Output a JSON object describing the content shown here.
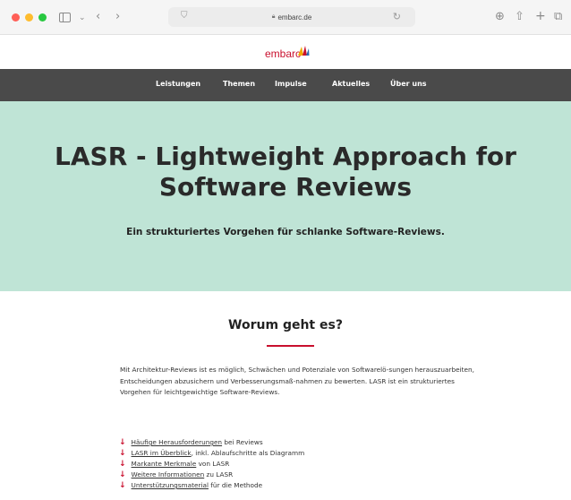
{
  "browser": {
    "url": "embarc.de",
    "icons": [
      "sidebar-icon",
      "chevron-down-icon",
      "back-icon",
      "forward-icon",
      "shield-icon",
      "reload-icon",
      "download-icon",
      "share-icon",
      "new-tab-icon",
      "tabs-icon"
    ]
  },
  "site": {
    "logo_text": "embarc",
    "brand_color": "#c9102e",
    "nav": [
      "Leistungen",
      "Themen",
      "Impulse",
      "Aktuelles",
      "Über uns"
    ]
  },
  "hero": {
    "title": "LASR - Lightweight Approach for Software Reviews",
    "subtitle": "Ein strukturiertes Vorgehen für schlanke Software-Reviews.",
    "background": "#bfe4d6"
  },
  "section": {
    "title": "Worum geht es?",
    "intro": "Mit Architektur-Reviews ist es möglich, Schwächen und Potenziale von Softwarelö-sungen herauszuarbeiten, Entscheidungen abzusichern und Verbesserungsmaß-nahmen zu bewerten. LASR ist ein strukturiertes Vorgehen für leichtgewichtige Software-Reviews.",
    "links": [
      {
        "link": "Häufige Herausforderungen",
        "rest": " bei Reviews"
      },
      {
        "link": "LASR im Überblick",
        "rest": ", inkl. Ablaufschritte als Diagramm"
      },
      {
        "link": "Markante Merkmale",
        "rest": " von LASR"
      },
      {
        "link": "Weitere Informationen",
        "rest": " zu LASR"
      },
      {
        "link": "Unterstützungsmaterial",
        "rest": " für die Methode"
      }
    ]
  }
}
